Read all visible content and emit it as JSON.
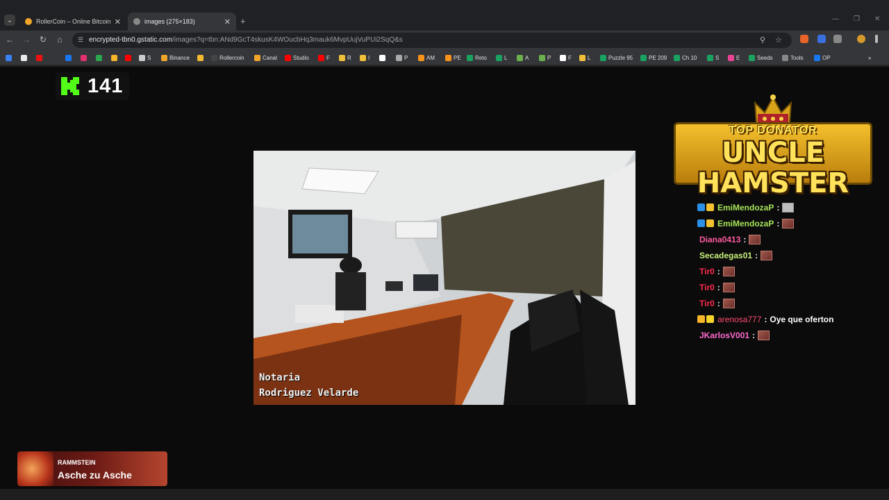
{
  "browser": {
    "tabs": [
      {
        "title": "RollerCoin – Online Bitcoin Min",
        "active": false,
        "favicon": "rollercoin-hamster-icon"
      },
      {
        "title": "images (275×183)",
        "active": true,
        "favicon": "globe-icon"
      }
    ],
    "url_host": "encrypted-tbn0.gstatic.com",
    "url_path": "/images?q=tbn:ANd9GcT4skusK4WOucbHq3mauk6MvpUujVuPUi2SqQ&s",
    "bookmarks": [
      "",
      "",
      "",
      "",
      "",
      "",
      "",
      "",
      "S",
      "Binance",
      "",
      "Rollercoin",
      "Canal",
      "Studio",
      "F",
      "R",
      "I",
      "",
      "P",
      "AM",
      "PE",
      "Reto",
      "L",
      "A",
      "P",
      "F",
      "L",
      "Puzzle 95",
      "PE 209",
      "Ch 10",
      "S",
      "E",
      "Seeds",
      "Tools",
      "OP"
    ]
  },
  "overlay": {
    "kick_viewers": "141",
    "photo_caption_line1": "Notaria",
    "photo_caption_line2": "Rodriguez Velarde",
    "top_donator_label": "TOP DONATOR",
    "top_donator_name": "UNCLE HAMSTER"
  },
  "chat": [
    {
      "user": "EmiMendozaP",
      "color": "#a6e35a",
      "badges": [
        "#2c8fe8",
        "#f2c230"
      ],
      "text": "",
      "emote": "avatar"
    },
    {
      "user": "EmiMendozaP",
      "color": "#a6e35a",
      "badges": [
        "#2c8fe8",
        "#f2c230"
      ],
      "text": "",
      "emote": "emote"
    },
    {
      "user": "Diana0413",
      "color": "#ff5aa0",
      "badges": [],
      "text": "",
      "emote": "emote"
    },
    {
      "user": "Secadegas01",
      "color": "#c8f07a",
      "badges": [],
      "text": "",
      "emote": "emote"
    },
    {
      "user": "Tir0",
      "color": "#ff2b4d",
      "badges": [],
      "text": "",
      "emote": "emote"
    },
    {
      "user": "Tir0",
      "color": "#ff2b4d",
      "badges": [],
      "text": "",
      "emote": "emote"
    },
    {
      "user": "Tir0",
      "color": "#ff2b4d",
      "badges": [],
      "text": "",
      "emote": "emote"
    },
    {
      "user": "arenosa777",
      "color": "#ff4a6e",
      "badges": [
        "#f7b52a",
        "#f7d42a"
      ],
      "text": "Oye que oferton",
      "emote": ""
    },
    {
      "user": "JKarlosV001",
      "color": "#ff6ad0",
      "badges": [],
      "text": "",
      "emote": "emote"
    }
  ],
  "now_playing": {
    "artist": "RAMMSTEIN",
    "song": "Asche zu Asche"
  }
}
